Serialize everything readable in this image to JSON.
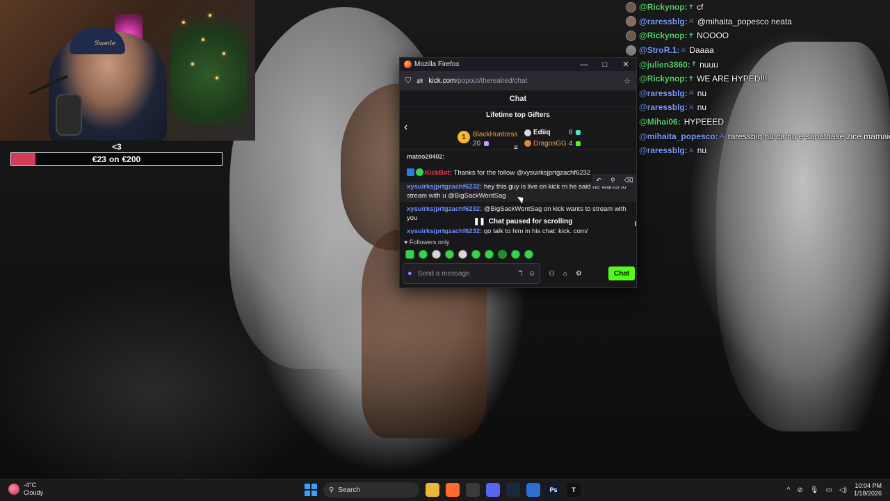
{
  "goal": {
    "label": "<3",
    "current": "€23",
    "connector": "on",
    "target": "€200",
    "progress_fraction": 0.115,
    "fill_color": "#d13d5a"
  },
  "overlay_chat": [
    {
      "user": "@Rickynop:",
      "badge": "✝",
      "message": "cf",
      "name_color": "#5bd16e",
      "avatar_color": "#6b5a4a"
    },
    {
      "user": "@raressblg:",
      "badge": "⚔",
      "message": "@mihaita_popesco neata",
      "name_color": "#7b9dff",
      "avatar_color": "#8a6a5a"
    },
    {
      "user": "@Rickynop:",
      "badge": "✝",
      "message": "NOOOO",
      "name_color": "#5bd16e",
      "avatar_color": "#6b5a4a"
    },
    {
      "user": "@StroR.1:",
      "badge": "⚔",
      "message": "Daaaa",
      "name_color": "#7b9dff",
      "avatar_color": "#8a8a8a"
    },
    {
      "user": "@julien3860:",
      "badge": "✝",
      "message": "nuuu",
      "name_color": "#5bd16e",
      "avatar_color": "#3a7a3a"
    },
    {
      "user": "@Rickynop:",
      "badge": "✝",
      "message": "WE ARE HYPED!!!",
      "name_color": "#5bd16e",
      "avatar_color": "#6b5a4a"
    },
    {
      "user": "@raressblg:",
      "badge": "⚔",
      "message": "nu",
      "name_color": "#7b9dff",
      "avatar_color": "#8a6a5a"
    },
    {
      "user": "@raressblg:",
      "badge": "⚔",
      "message": "nu",
      "name_color": "#7b9dff",
      "avatar_color": "#8a6a5a"
    },
    {
      "user": "@Mihai06:",
      "badge": "",
      "message": "HYPEEED",
      "name_color": "#5bd16e",
      "avatar_color": "#c0302a"
    },
    {
      "user": "@mihaita_popesco:",
      "badge": "⚔",
      "message": "raressblg nu ca nu e sanatoase zice mamaie",
      "name_color": "#7b9dff",
      "avatar_color": "#4a4a7a"
    },
    {
      "user": "@raressblg:",
      "badge": "⚔",
      "message": "nu",
      "name_color": "#7b9dff",
      "avatar_color": "#8a6a5a"
    }
  ],
  "browser": {
    "window_title": "Mozilla Firefox",
    "url_host": "kick.com",
    "url_path": "/popout/therealred/chat",
    "minimize": "—",
    "maximize": "□",
    "close": "✕"
  },
  "kick": {
    "header": "Chat",
    "gifters_title": "Lifetime top Gifters",
    "rank1_number": "1",
    "gifters": [
      {
        "name": "BlackHuntress",
        "count": "20",
        "color": "#e8a63a"
      },
      {
        "name": "Ediiq",
        "count": "8",
        "color": "#ffffff"
      },
      {
        "name": "DragosGG",
        "count": "4",
        "color": "#f0a040"
      }
    ],
    "cut_line": "mateo20402:",
    "messages": [
      {
        "user": "KickBot:",
        "text": " Thanks for the follow @xysuirksjprtgzachf6232",
        "bot": true
      },
      {
        "user": "xysuirksjprtgzachf6232:",
        "text": " hey this guy is live on kick rn he said he wants to stream with u @BigSackWontSag",
        "bot": false
      },
      {
        "user": "xysuirksjprtgzachf6232:",
        "text": " @BigSackWontSag on kick wants to stream with you",
        "bot": false
      },
      {
        "user": "xysuirksjprtgzachf6232:",
        "text": " go talk to him in his chat: kick. com/",
        "bot": false
      }
    ],
    "paused_text": "Chat paused for scrolling",
    "followers_only": "Followers only",
    "input_placeholder": "Send a message",
    "chat_button": "Chat",
    "accent_color": "#53fc18"
  },
  "taskbar": {
    "temperature": "-4°C",
    "condition": "Cloudy",
    "search_label": "Search",
    "time": "10:04 PM",
    "date": "1/18/2026",
    "apps": [
      {
        "name": "file-explorer-icon",
        "glyph": "",
        "color": "#e9b73a"
      },
      {
        "name": "firefox-icon",
        "glyph": "",
        "color": "#ff6a2a"
      },
      {
        "name": "obs-icon",
        "glyph": "",
        "color": "#3a3a3a"
      },
      {
        "name": "discord-icon",
        "glyph": "",
        "color": "#5865f2"
      },
      {
        "name": "steam-icon",
        "glyph": "",
        "color": "#1b2838"
      },
      {
        "name": "app-blue-icon",
        "glyph": "",
        "color": "#2a6fd6"
      },
      {
        "name": "photoshop-icon",
        "glyph": "Ps",
        "color": "#0a1b33"
      },
      {
        "name": "tiktok-studio-icon",
        "glyph": "T",
        "color": "#111111"
      }
    ]
  }
}
